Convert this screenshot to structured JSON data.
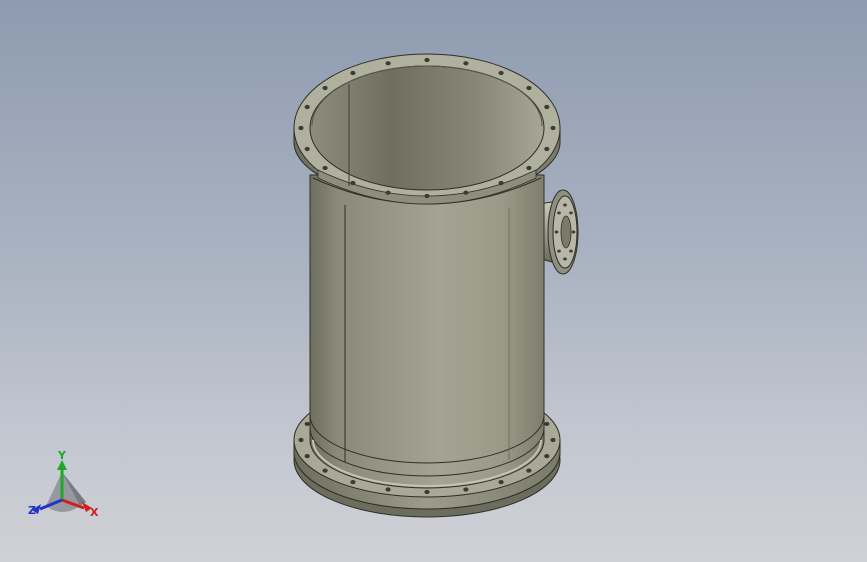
{
  "viewport": {
    "background_top": "#8e9bb0",
    "background_bottom": "#cfd1d6"
  },
  "model": {
    "part_color": "#8a8a78",
    "highlight_color": "#b5b5a4",
    "shadow_color": "#55554a",
    "bolt_hole_color": "#3c3c34"
  },
  "triad": {
    "x_label": "X",
    "y_label": "Y",
    "z_label": "Z",
    "x_color": "#d21e1e",
    "y_color": "#1fa82a",
    "z_color": "#2332c8"
  }
}
